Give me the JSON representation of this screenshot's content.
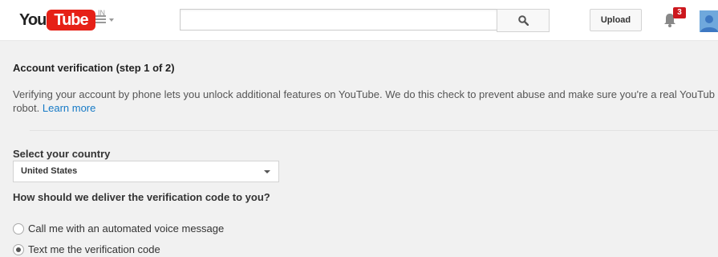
{
  "header": {
    "logo_you": "You",
    "logo_tube": "Tube",
    "logo_region": "IN",
    "search": {
      "value": "",
      "placeholder": ""
    },
    "upload_label": "Upload",
    "notification_count": "3"
  },
  "main": {
    "title": "Account verification (step 1 of 2)",
    "description": "Verifying your account by phone lets you unlock additional features on YouTube. We do this check to prevent abuse and make sure you're a real YouTub",
    "description_cont": "robot.",
    "learn_more": "Learn more",
    "country_label": "Select your country",
    "country_selected": "United States",
    "delivery_question": "How should we deliver the verification code to you?",
    "options": [
      {
        "label": "Call me with an automated voice message",
        "checked": false
      },
      {
        "label": "Text me the verification code",
        "checked": true
      }
    ]
  },
  "colors": {
    "brand_red": "#e62117",
    "link": "#167ac6",
    "badge": "#cc181e",
    "background": "#f1f1f1"
  },
  "icons": [
    "guide-menu-icon",
    "search-icon",
    "bell-icon",
    "avatar-icon",
    "dropdown-caret-icon"
  ]
}
